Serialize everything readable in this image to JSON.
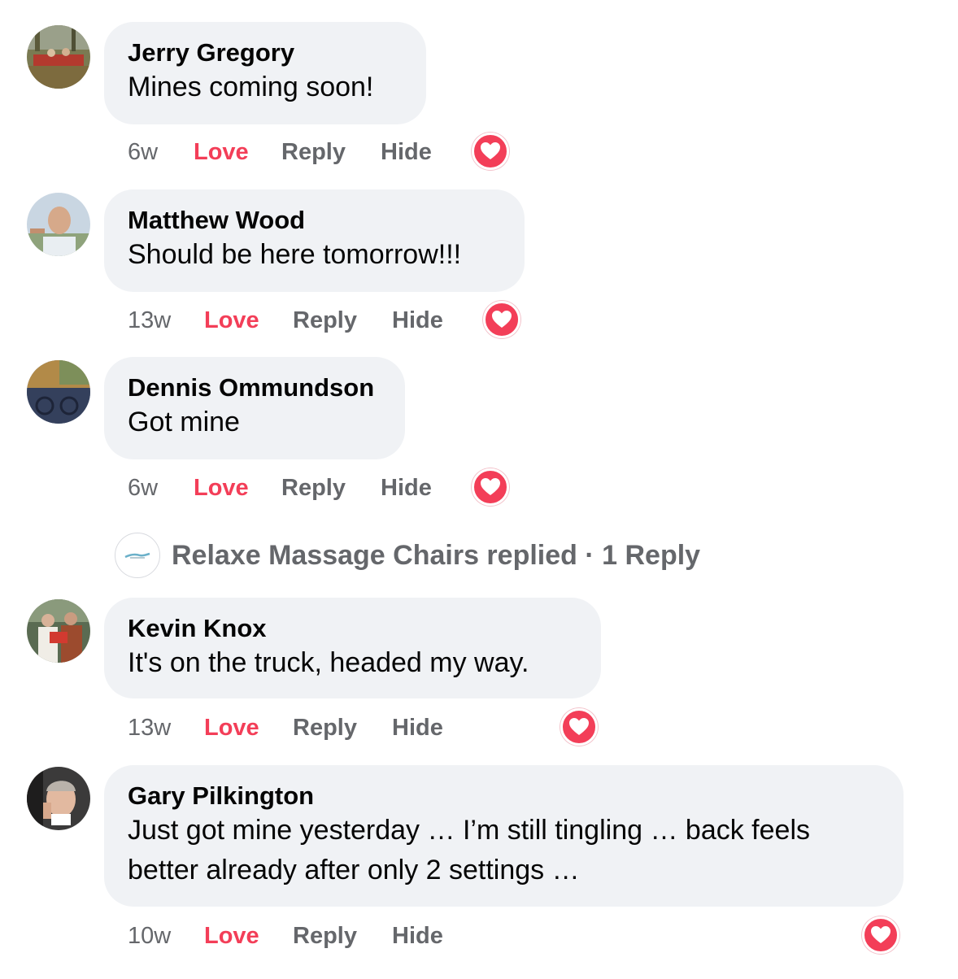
{
  "comments": [
    {
      "author": "Jerry Gregory",
      "text_lines": [
        "Mines coming soon!"
      ],
      "time": "6w",
      "love": "Love",
      "reply": "Reply",
      "hide": "Hide",
      "reaction": "love-reaction"
    },
    {
      "author": "Matthew Wood",
      "text_lines": [
        "Should be here tomorrow!!!"
      ],
      "time": "13w",
      "love": "Love",
      "reply": "Reply",
      "hide": "Hide",
      "reaction": "love-reaction"
    },
    {
      "author": "Dennis Ommundson",
      "text_lines": [
        "Got mine"
      ],
      "time": "6w",
      "love": "Love",
      "reply": "Reply",
      "hide": "Hide",
      "reaction": "love-reaction"
    },
    {
      "author": "Kevin Knox",
      "text_lines": [
        "It's on the truck, headed my way."
      ],
      "time": "13w",
      "love": "Love",
      "reply": "Reply",
      "hide": "Hide",
      "reaction": "love-reaction"
    },
    {
      "author": "Gary Pilkington",
      "text_lines": [
        "Just got mine yesterday … I’m still tingling … back feels",
        "better already after only 2 settings …"
      ],
      "time": "10w",
      "love": "Love",
      "reply": "Reply",
      "hide": "Hide",
      "reaction": "love-reaction"
    }
  ],
  "replied": {
    "text": "Relaxe Massage Chairs replied · 1 Reply"
  },
  "colors": {
    "love": "#f33e58",
    "muted": "#65676b",
    "bubble": "#f0f2f5",
    "text": "#050505"
  }
}
